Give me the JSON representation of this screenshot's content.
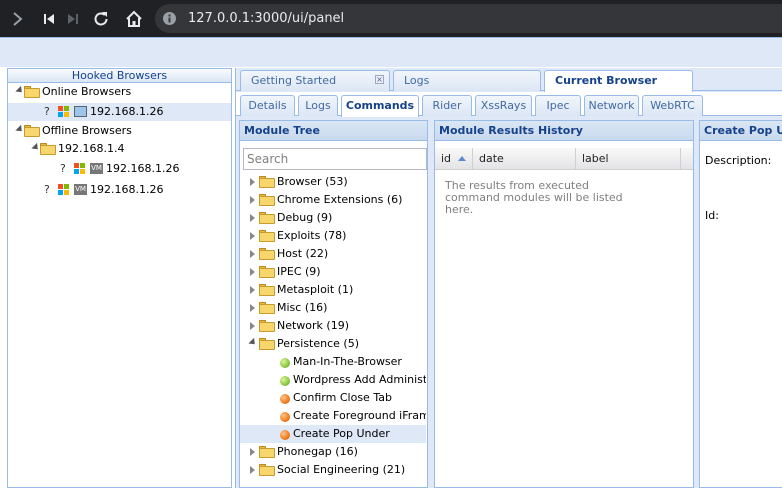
{
  "browser": {
    "url": "127.0.0.1:3000/ui/panel"
  },
  "left_panel": {
    "title": "Hooked Browsers",
    "online_label": "Online Browsers",
    "online_ip": "192.168.1.26",
    "offline_label": "Offline Browsers",
    "offline_group": "192.168.1.4",
    "offline_ip_1": "192.168.1.26",
    "offline_ip_2": "192.168.1.26",
    "unknown_glyph": "?",
    "vm_badge": "VM"
  },
  "top_tabs": [
    {
      "label": "Getting Started",
      "closable": true
    },
    {
      "label": "Logs"
    },
    {
      "label": "Current Browser",
      "active": true
    }
  ],
  "sub_tabs": [
    {
      "label": "Details"
    },
    {
      "label": "Logs"
    },
    {
      "label": "Commands",
      "active": true
    },
    {
      "label": "Rider"
    },
    {
      "label": "XssRays"
    },
    {
      "label": "Ipec"
    },
    {
      "label": "Network"
    },
    {
      "label": "WebRTC"
    }
  ],
  "module_tree": {
    "title": "Module Tree",
    "search_placeholder": "Search",
    "categories": [
      "Browser (53)",
      "Chrome Extensions (6)",
      "Debug (9)",
      "Exploits (78)",
      "Host (22)",
      "IPEC (9)",
      "Metasploit (1)",
      "Misc (16)",
      "Network (19)",
      "Persistence (5)",
      "Phonegap (16)",
      "Social Engineering (21)"
    ],
    "persistence_modules": [
      {
        "label": "Man-In-The-Browser",
        "status": "green"
      },
      {
        "label": "Wordpress Add Administrator",
        "status": "green"
      },
      {
        "label": "Confirm Close Tab",
        "status": "orange"
      },
      {
        "label": "Create Foreground iFrame",
        "status": "orange"
      },
      {
        "label": "Create Pop Under",
        "status": "orange",
        "selected": true
      }
    ]
  },
  "results": {
    "title": "Module Results History",
    "columns": [
      "id",
      "date",
      "label"
    ],
    "empty_text": "The results from executed command modules will be listed here."
  },
  "detail": {
    "title": "Create Pop Under",
    "description_label": "Description:",
    "id_label": "Id:"
  },
  "colors": {
    "chrome_bg": "#202124",
    "panel_border": "#99bbe8",
    "panel_header_text": "#15428b",
    "status_green": "#8cc63f",
    "status_orange": "#f07c1e"
  }
}
